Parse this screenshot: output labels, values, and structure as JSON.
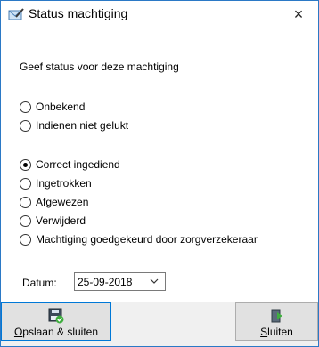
{
  "window": {
    "title": "Status machtiging",
    "close_glyph": "×"
  },
  "prompt": "Geef status voor deze machtiging",
  "group1": [
    {
      "label": "Onbekend",
      "checked": false
    },
    {
      "label": "Indienen niet gelukt",
      "checked": false
    }
  ],
  "group2": [
    {
      "label": "Correct ingediend",
      "checked": true
    },
    {
      "label": "Ingetrokken",
      "checked": false
    },
    {
      "label": "Afgewezen",
      "checked": false
    },
    {
      "label": "Verwijderd",
      "checked": false
    },
    {
      "label": "Machtiging goedgekeurd door zorgverzekeraar",
      "checked": false
    }
  ],
  "date": {
    "label": "Datum:",
    "value": "25-09-2018"
  },
  "buttons": {
    "save_mnemonic": "O",
    "save_rest": "pslaan & sluiten",
    "close_mnemonic": "S",
    "close_rest": "luiten"
  },
  "icons": {
    "title": "envelope-pen-icon",
    "save": "save-check-icon",
    "close": "exit-door-icon",
    "date_dropdown": "chevron-down-icon"
  },
  "colors": {
    "accent": "#0078d7",
    "window_border": "#2b79c6"
  }
}
